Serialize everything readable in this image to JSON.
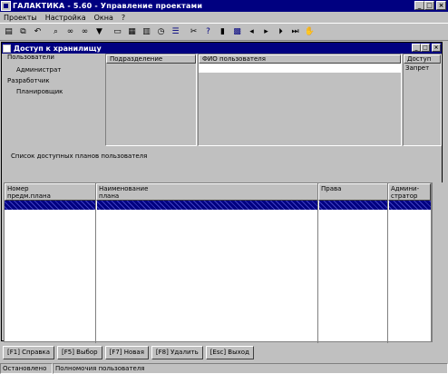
{
  "window": {
    "title": "ГАЛАКТИКА - 5.60 - Управление проектами",
    "minimize": "_",
    "maximize": "□",
    "close": "×"
  },
  "menu": {
    "items": [
      "Проекты",
      "Настройка",
      "Окна",
      "?"
    ]
  },
  "toolbar": {
    "buttons": [
      "new-doc-icon",
      "copy-icon",
      "undo-icon",
      "find-icon",
      "binoculars-icon",
      "binoculars-next-icon",
      "filter-icon",
      "folder-icon",
      "print-icon",
      "calendar-icon",
      "clock-icon",
      "list-icon",
      "scissors-icon",
      "help-icon",
      "info-icon",
      "grid-icon",
      "first-icon",
      "prev-icon",
      "next-icon",
      "last-icon",
      "hand-icon"
    ]
  },
  "child": {
    "title": "Доступ к хранилищу",
    "minimize": "_",
    "maximize": "□",
    "close": "×"
  },
  "upper": {
    "col_users": "Пользователи",
    "labels": [
      "Администрат",
      "Разработчик",
      "Планировщик"
    ],
    "col_group": "Подразделение",
    "col_fio": "ФИО пользователя",
    "col_access": "Доступ",
    "access_value": "Запрет"
  },
  "plans_caption": "Список доступных планов пользователя",
  "grid": {
    "headers": [
      {
        "line1": "Номер",
        "line2": "предм.плана"
      },
      {
        "line1": "Наименование",
        "line2": "плана"
      },
      {
        "line1": "Права",
        "line2": ""
      },
      {
        "line1": "Админи-",
        "line2": "стратор"
      }
    ]
  },
  "fkeys": [
    "[F1] Справка",
    "[F5] Выбор",
    "[F7] Новая",
    "[F8] Удалить",
    "[Esc] Выход"
  ],
  "status": {
    "left": "Остановлено",
    "right": "Полномочия пользователя"
  },
  "colors": {
    "titlebar": "#000080",
    "face": "#c0c0c0",
    "selection": "#000080"
  }
}
